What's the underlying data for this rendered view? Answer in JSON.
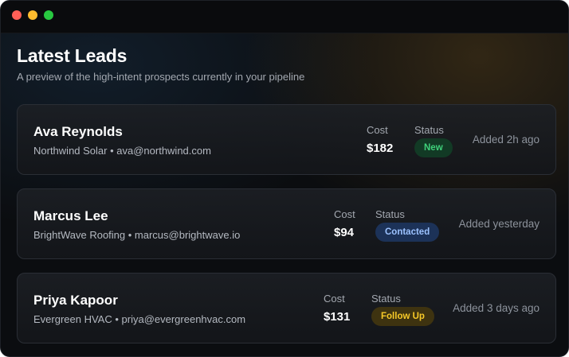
{
  "header": {
    "title": "Latest Leads",
    "subtitle": "A preview of the high-intent prospects currently in your pipeline"
  },
  "labels": {
    "cost": "Cost",
    "status": "Status"
  },
  "leads": [
    {
      "name": "Ava Reynolds",
      "meta": "Northwind Solar • ava@northwind.com",
      "cost": "$182",
      "status": "New",
      "added": "Added 2h ago"
    },
    {
      "name": "Marcus Lee",
      "meta": "BrightWave Roofing • marcus@brightwave.io",
      "cost": "$94",
      "status": "Contacted",
      "added": "Added yesterday"
    },
    {
      "name": "Priya Kapoor",
      "meta": "Evergreen HVAC • priya@evergreenhvac.com",
      "cost": "$131",
      "status": "Follow Up",
      "added": "Added 3 days ago"
    }
  ],
  "colors": {
    "status_new": "#3fd07a",
    "status_contacted": "#9cc2ff",
    "status_follow_up": "#f7c928",
    "window_close": "#ff5f57",
    "window_minimize": "#febc2e",
    "window_maximize": "#28c840"
  }
}
